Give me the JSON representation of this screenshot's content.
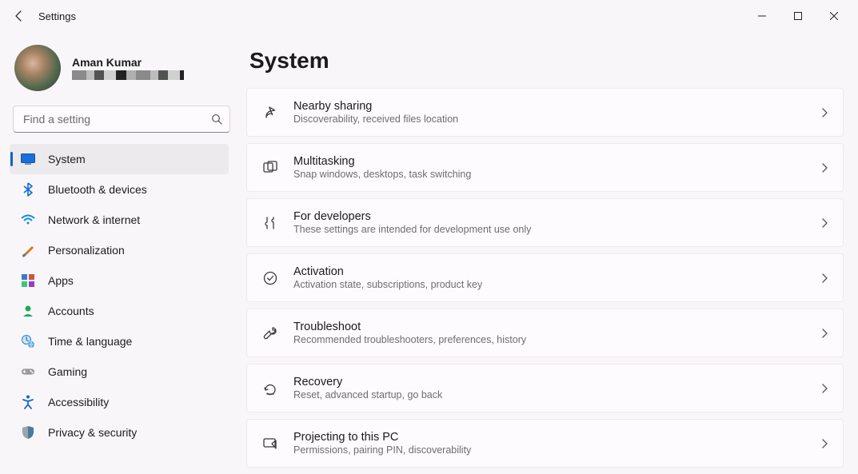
{
  "window": {
    "title": "Settings"
  },
  "profile": {
    "name": "Aman Kumar"
  },
  "search": {
    "placeholder": "Find a setting"
  },
  "nav": [
    {
      "id": "system",
      "label": "System",
      "icon": "system",
      "active": true
    },
    {
      "id": "bluetooth",
      "label": "Bluetooth & devices",
      "icon": "bluetooth"
    },
    {
      "id": "network",
      "label": "Network & internet",
      "icon": "wifi"
    },
    {
      "id": "personalization",
      "label": "Personalization",
      "icon": "brush"
    },
    {
      "id": "apps",
      "label": "Apps",
      "icon": "apps"
    },
    {
      "id": "accounts",
      "label": "Accounts",
      "icon": "person"
    },
    {
      "id": "time",
      "label": "Time & language",
      "icon": "clock-globe"
    },
    {
      "id": "gaming",
      "label": "Gaming",
      "icon": "gamepad"
    },
    {
      "id": "accessibility",
      "label": "Accessibility",
      "icon": "accessibility"
    },
    {
      "id": "privacy",
      "label": "Privacy & security",
      "icon": "shield"
    }
  ],
  "page": {
    "title": "System"
  },
  "cards": [
    {
      "id": "nearby",
      "title": "Nearby sharing",
      "sub": "Discoverability, received files location",
      "icon": "share"
    },
    {
      "id": "multitask",
      "title": "Multitasking",
      "sub": "Snap windows, desktops, task switching",
      "icon": "windows"
    },
    {
      "id": "developers",
      "title": "For developers",
      "sub": "These settings are intended for development use only",
      "icon": "tools"
    },
    {
      "id": "activation",
      "title": "Activation",
      "sub": "Activation state, subscriptions, product key",
      "icon": "check-circle"
    },
    {
      "id": "troubleshoot",
      "title": "Troubleshoot",
      "sub": "Recommended troubleshooters, preferences, history",
      "icon": "wrench"
    },
    {
      "id": "recovery",
      "title": "Recovery",
      "sub": "Reset, advanced startup, go back",
      "icon": "recovery"
    },
    {
      "id": "projecting",
      "title": "Projecting to this PC",
      "sub": "Permissions, pairing PIN, discoverability",
      "icon": "project"
    }
  ]
}
